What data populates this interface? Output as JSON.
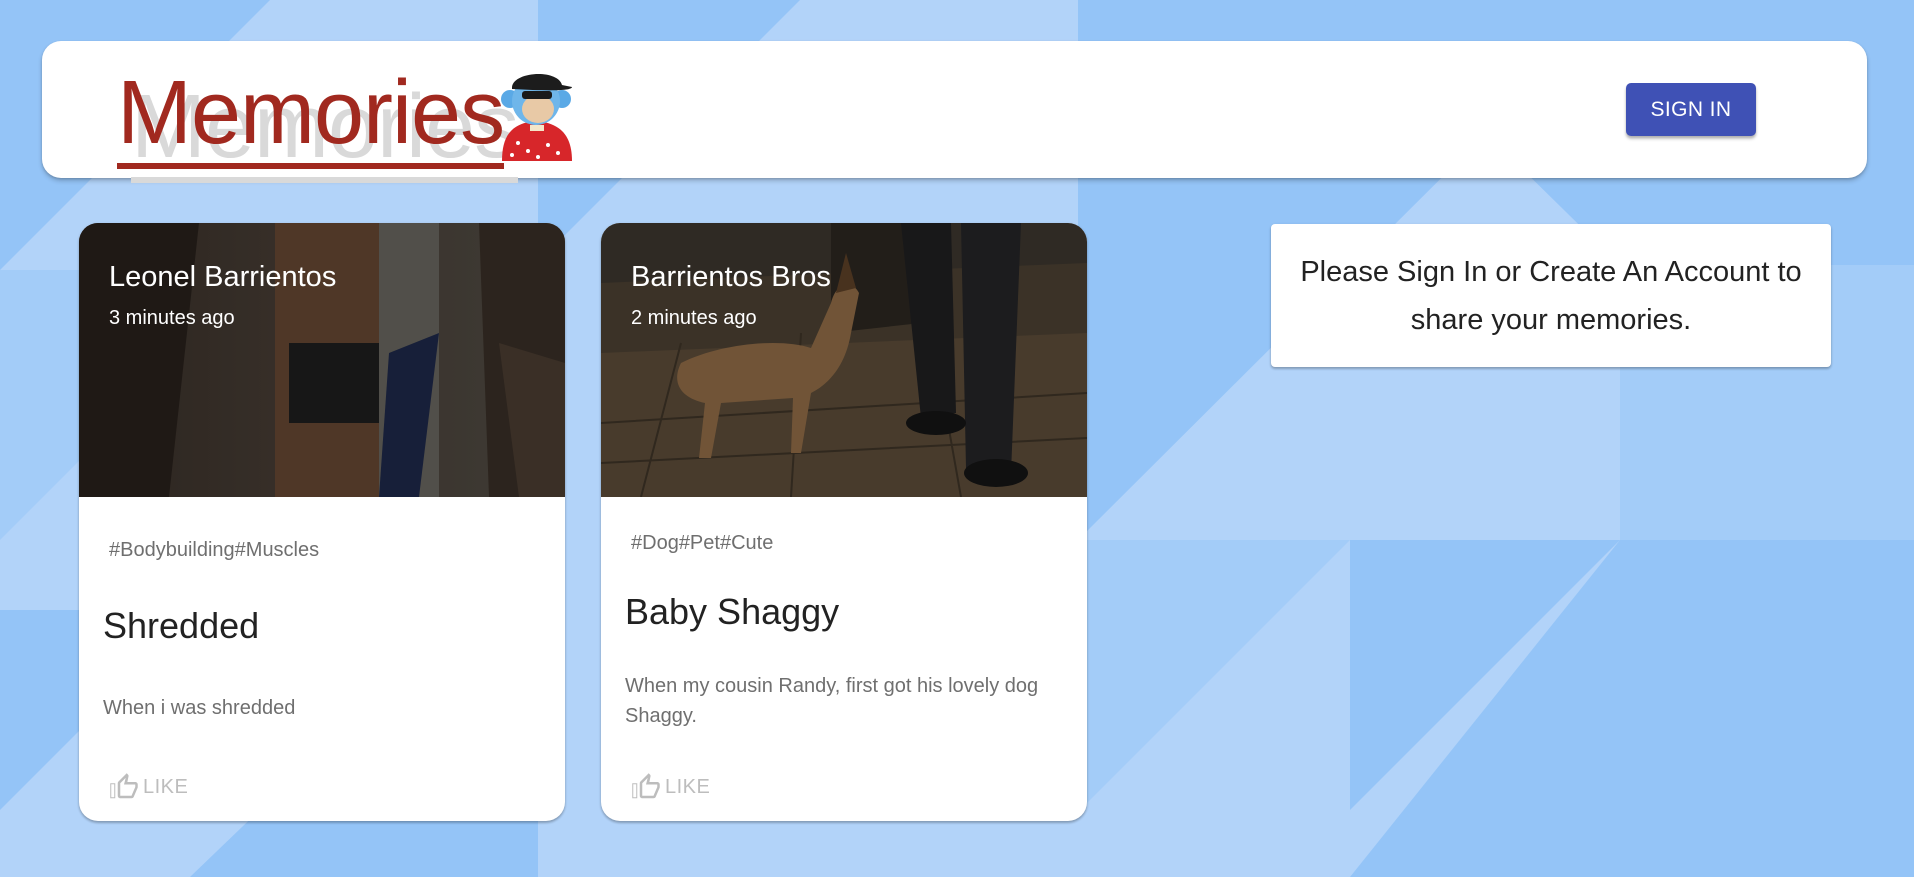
{
  "app": {
    "title": "Memories",
    "logo_icon": "monkey-avatar-icon",
    "signin_label": "SIGN IN"
  },
  "colors": {
    "brand": "#a1291f",
    "primary": "#3f51b5",
    "background_light": "#b2d3f9",
    "background_dark": "#94c4f7"
  },
  "posts": [
    {
      "author": "Leonel Barrientos",
      "time": "3 minutes ago",
      "tags": "#Bodybuilding#Muscles",
      "title": "Shredded",
      "message": "When i was shredded",
      "like_label": "LIKE",
      "like_icon": "thumb-up-outline-icon"
    },
    {
      "author": "Barrientos Bros",
      "time": "2 minutes ago",
      "tags": "#Dog#Pet#Cute",
      "title": "Baby Shaggy",
      "message": "When my cousin Randy, first got his lovely dog Shaggy.",
      "like_label": "LIKE",
      "like_icon": "thumb-up-outline-icon"
    }
  ],
  "signin_prompt": "Please Sign In or Create An Account to share your memories."
}
